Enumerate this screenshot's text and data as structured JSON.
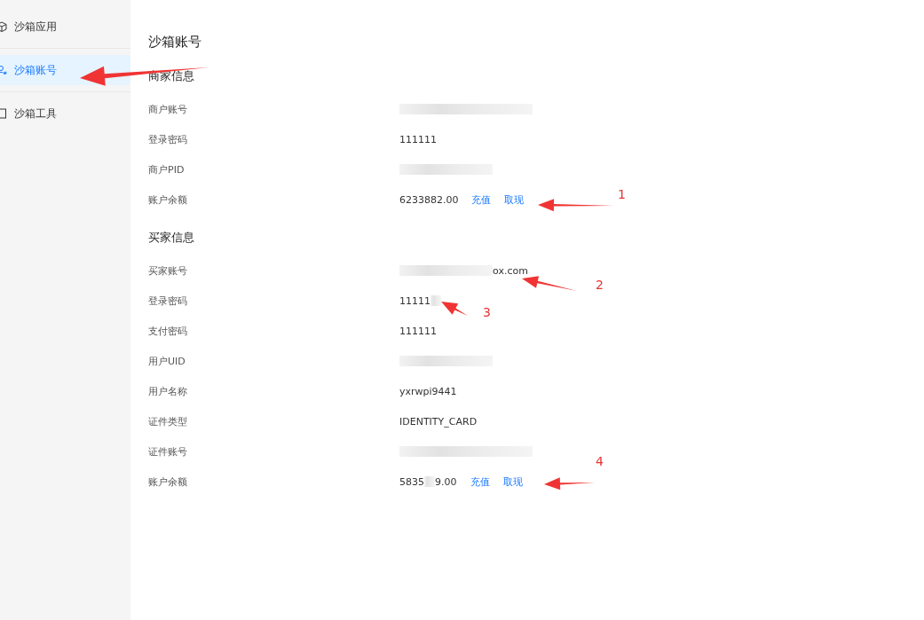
{
  "sidebar": {
    "items": [
      {
        "label": "沙箱应用",
        "kind": "cube",
        "selected": false
      },
      {
        "label": "沙箱账号",
        "kind": "user",
        "selected": true
      },
      {
        "label": "沙箱工具",
        "kind": "book",
        "selected": false
      }
    ]
  },
  "page": {
    "title": "沙箱账号"
  },
  "sections": [
    {
      "heading": "商家信息",
      "rows": [
        {
          "label": "商户账号",
          "value": [
            {
              "kind": "blur-long"
            }
          ]
        },
        {
          "label": "登录密码",
          "value": [
            {
              "kind": "text",
              "text": "111111"
            }
          ]
        },
        {
          "label": "商户PID",
          "value": [
            {
              "kind": "blur"
            }
          ]
        },
        {
          "label": "账户余额",
          "value": [
            {
              "kind": "text",
              "text": "6233882.00"
            }
          ],
          "actions": [
            "充值",
            "取现"
          ]
        }
      ]
    },
    {
      "heading": "买家信息",
      "rows": [
        {
          "label": "买家账号",
          "value": [
            {
              "kind": "blur"
            },
            {
              "kind": "text",
              "text": "ox.com"
            }
          ]
        },
        {
          "label": "登录密码",
          "value": [
            {
              "kind": "text",
              "text": "11111"
            },
            {
              "kind": "blur-short"
            }
          ]
        },
        {
          "label": "支付密码",
          "value": [
            {
              "kind": "text",
              "text": "111111"
            }
          ]
        },
        {
          "label": "用户UID",
          "value": [
            {
              "kind": "blur"
            }
          ]
        },
        {
          "label": "用户名称",
          "value": [
            {
              "kind": "text",
              "text": "yxrwpi9441"
            }
          ]
        },
        {
          "label": "证件类型",
          "value": [
            {
              "kind": "text",
              "text": "IDENTITY_CARD"
            }
          ]
        },
        {
          "label": "证件账号",
          "value": [
            {
              "kind": "blur-long"
            }
          ]
        },
        {
          "label": "账户余额",
          "value": [
            {
              "kind": "text",
              "text": "5835"
            },
            {
              "kind": "blur-short"
            },
            {
              "kind": "text",
              "text": "9.00"
            }
          ],
          "actions": [
            "充值",
            "取现"
          ]
        }
      ]
    }
  ],
  "annotations": [
    {
      "kind": "arrow"
    },
    {
      "kind": "numbered",
      "label": "1"
    },
    {
      "kind": "numbered",
      "label": "2"
    },
    {
      "kind": "numbered",
      "label": "3"
    },
    {
      "kind": "numbered",
      "label": "4"
    }
  ]
}
